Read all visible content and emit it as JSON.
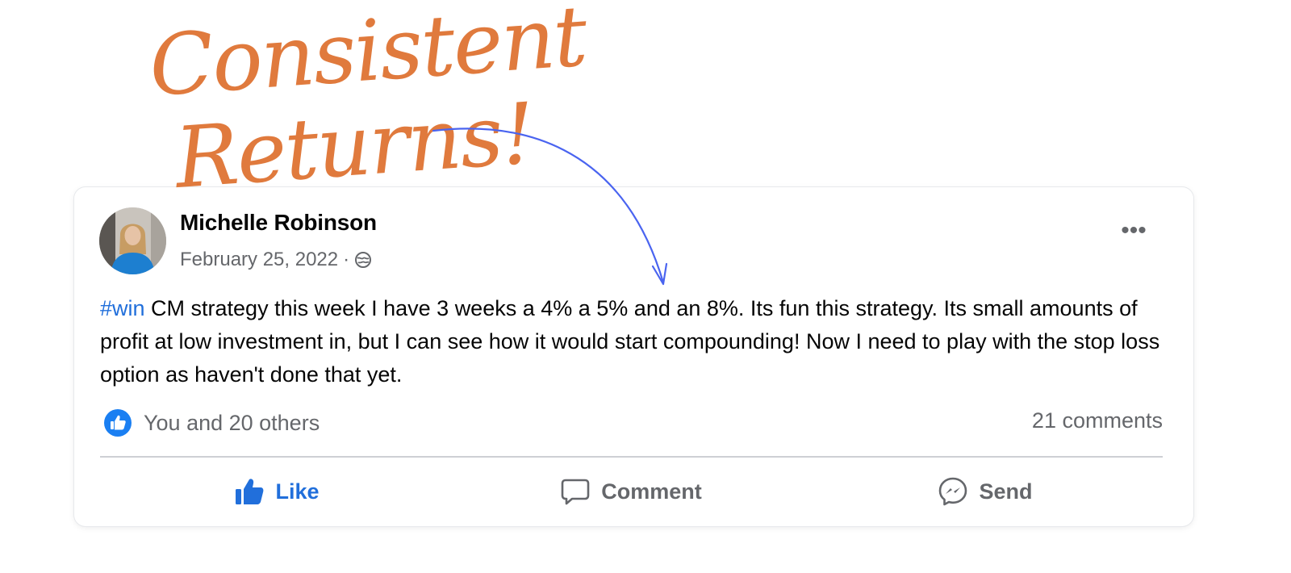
{
  "annotation": {
    "headline_line1": "Consistent",
    "headline_line2": "Returns!",
    "headline_color": "#e07a3d",
    "arrow_color": "#4a64f0"
  },
  "post": {
    "author": "Michelle Robinson",
    "date": "February 25, 2022",
    "separator": "·",
    "privacy_icon": "globe-icon",
    "more_label": "•••",
    "hashtag": "#win",
    "text_after_hashtag": " CM strategy this week I have 3 weeks a 4% a 5% and an 8%. Its fun this strategy. Its small amounts of profit at low investment in, but I can see how it would start compounding! Now I need to play with the stop loss option as haven't done that yet.",
    "reactions_text": "You and 20 others",
    "comments_text": "21 comments",
    "actions": {
      "like": "Like",
      "comment": "Comment",
      "send": "Send"
    }
  },
  "colors": {
    "link_blue": "#216fdb",
    "muted_text": "#65676b",
    "divider": "#ced0d4"
  }
}
